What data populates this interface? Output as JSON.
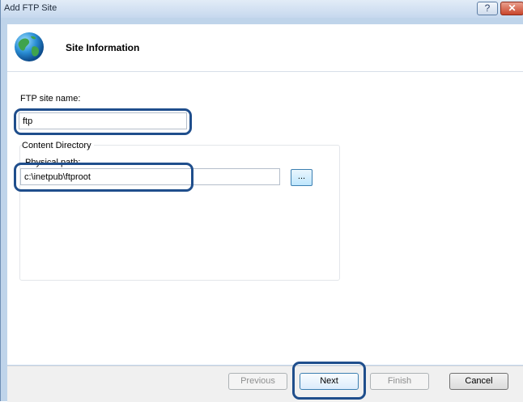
{
  "window": {
    "title": "Add FTP Site",
    "help_glyph": "?",
    "close_glyph": "✕"
  },
  "header": {
    "title": "Site Information",
    "icon": "globe-icon"
  },
  "form": {
    "site_name_label": "FTP site name:",
    "site_name_value": "ftp",
    "content_directory_label": "Content Directory",
    "physical_path_label": "Physical path:",
    "physical_path_value": "c:\\inetpub\\ftproot",
    "browse_label": "..."
  },
  "footer": {
    "previous_label": "Previous",
    "next_label": "Next",
    "finish_label": "Finish",
    "cancel_label": "Cancel"
  },
  "colors": {
    "highlight": "#1f4e8c",
    "frame": "#bfd4ea"
  }
}
